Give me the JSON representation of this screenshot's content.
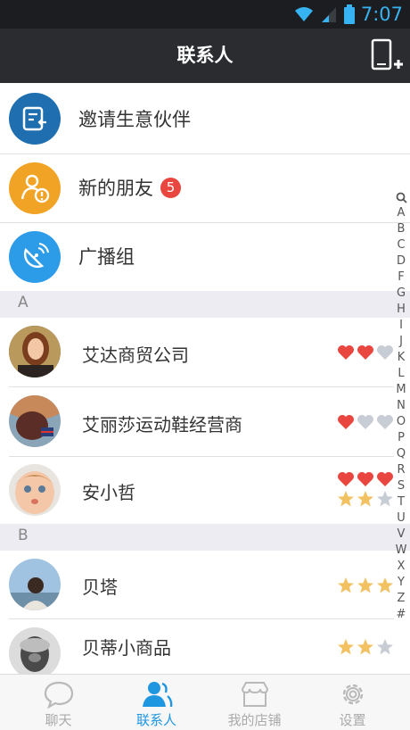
{
  "status_bar": {
    "time": "7:07"
  },
  "header": {
    "title": "联系人"
  },
  "function_items": [
    {
      "label": "邀请生意伙伴",
      "icon": "invite-partner-icon",
      "color": "#1f6fb0"
    },
    {
      "label": "新的朋友",
      "badge": "5",
      "icon": "new-friend-icon",
      "color": "#f1a325"
    },
    {
      "label": "广播组",
      "icon": "broadcast-icon",
      "color": "#2d9ce8"
    }
  ],
  "sections": [
    {
      "letter": "A",
      "contacts": [
        {
          "name": "艾达商贸公司",
          "hearts": 2,
          "stars": 0
        },
        {
          "name": "艾丽莎运动鞋经营商",
          "hearts": 1,
          "stars": 0
        },
        {
          "name": "安小哲",
          "hearts": 3,
          "stars": 2
        }
      ]
    },
    {
      "letter": "B",
      "contacts": [
        {
          "name": "贝塔",
          "hearts": 0,
          "stars": 3
        },
        {
          "name": "贝蒂小商品",
          "hearts": 0,
          "stars": 2
        }
      ]
    }
  ],
  "index_letters": [
    "A",
    "B",
    "C",
    "D",
    "F",
    "G",
    "H",
    "I",
    "J",
    "K",
    "L",
    "M",
    "N",
    "O",
    "P",
    "Q",
    "R",
    "S",
    "T",
    "U",
    "V",
    "W",
    "X",
    "Y",
    "Z",
    "#"
  ],
  "tabs": [
    {
      "label": "聊天",
      "icon": "chat-icon",
      "active": false
    },
    {
      "label": "联系人",
      "icon": "contacts-icon",
      "active": true
    },
    {
      "label": "我的店铺",
      "icon": "store-icon",
      "active": false
    },
    {
      "label": "设置",
      "icon": "settings-gear-icon",
      "active": false
    }
  ],
  "colors": {
    "heart_on": "#e8463f",
    "rating_off": "#c8ccd4",
    "star_on": "#f2c262",
    "active_tab": "#1f96e0"
  }
}
